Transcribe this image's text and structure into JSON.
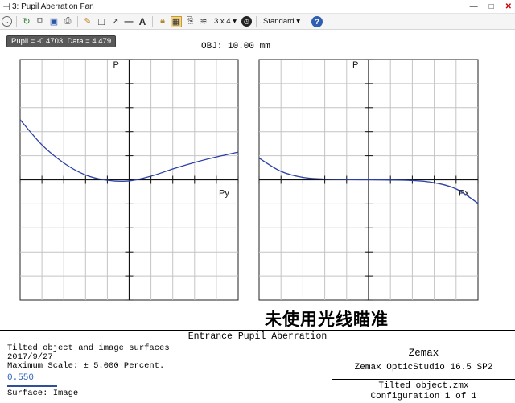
{
  "window": {
    "title": "3: Pupil Aberration Fan",
    "pin_icon": "pin-icon"
  },
  "toolbar": {
    "layout_label": "3 x 4 ▾",
    "standard_label": "Standard ▾"
  },
  "tooltip": {
    "text": "Pupil = -0.4703, Data = 4.479"
  },
  "plot": {
    "obj_label": "OBJ: 10.00 mm",
    "overlay_text": "未使用光线瞄准"
  },
  "chart_data": [
    {
      "type": "line",
      "ylabel": "P",
      "xlabel": "Py",
      "xlim": [
        -1,
        1
      ],
      "ylim": [
        -5,
        5
      ],
      "grid": true,
      "series_color": "#2b3fa8",
      "x": [
        -1.0,
        -0.8,
        -0.6,
        -0.4,
        -0.2,
        0.0,
        0.2,
        0.4,
        0.6,
        0.8,
        1.0
      ],
      "values": [
        2.5,
        1.45,
        0.7,
        0.2,
        -0.02,
        -0.05,
        0.15,
        0.45,
        0.72,
        0.95,
        1.15
      ]
    },
    {
      "type": "line",
      "ylabel": "P",
      "xlabel": "Px",
      "xlim": [
        -1,
        1
      ],
      "ylim": [
        -5,
        5
      ],
      "grid": true,
      "series_color": "#2b3fa8",
      "x": [
        -1.0,
        -0.8,
        -0.6,
        -0.4,
        -0.2,
        0.0,
        0.2,
        0.4,
        0.6,
        0.8,
        1.0
      ],
      "values": [
        0.9,
        0.35,
        0.1,
        0.03,
        0.01,
        0.0,
        -0.01,
        -0.03,
        -0.12,
        -0.38,
        -0.98
      ]
    }
  ],
  "info": {
    "header": "Entrance Pupil Aberration",
    "line1": "Tilted object and image surfaces",
    "line2": "2017/9/27",
    "line3": "Maximum Scale: ± 5.000 Percent.",
    "wavelength": "0.550",
    "line4": "Surface: Image",
    "brand": "Zemax",
    "version": "Zemax OpticStudio 16.5 SP2",
    "file": "Tilted object.zmx",
    "config": "Configuration 1 of 1"
  }
}
